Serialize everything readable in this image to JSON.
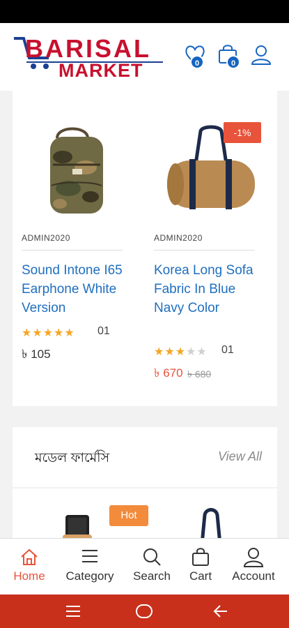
{
  "header": {
    "logo_line1": "BARISAL",
    "logo_line2": "MARKET",
    "wishlist_count": "0",
    "cart_count": "0"
  },
  "products": [
    {
      "vendor": "ADMIN2020",
      "name": "Sound Intone I65 Earphone White Version",
      "rating": 5,
      "review_count": "01",
      "price": "৳ 105",
      "old_price": "",
      "discount_tag": ""
    },
    {
      "vendor": "ADMIN2020",
      "name": "Korea Long Sofa Fabric In Blue Navy Color",
      "rating": 3,
      "review_count": "01",
      "price": "৳ 670",
      "old_price": "৳ 680",
      "discount_tag": "-1%"
    }
  ],
  "section": {
    "title": "মডেল ফার্মেসি",
    "view_all": "View All",
    "hot_tag": "Hot"
  },
  "bottom_nav": [
    {
      "label": "Home",
      "icon": "home-icon",
      "active": true
    },
    {
      "label": "Category",
      "icon": "menu-icon",
      "active": false
    },
    {
      "label": "Search",
      "icon": "search-icon",
      "active": false
    },
    {
      "label": "Cart",
      "icon": "cart-icon",
      "active": false
    },
    {
      "label": "Account",
      "icon": "account-icon",
      "active": false
    }
  ],
  "colors": {
    "brand_red": "#c8102e",
    "brand_blue": "#1c3f94",
    "accent_orange": "#e8533b",
    "link_blue": "#1f6fbf",
    "star": "#f5a623",
    "system_nav": "#c8301c"
  }
}
